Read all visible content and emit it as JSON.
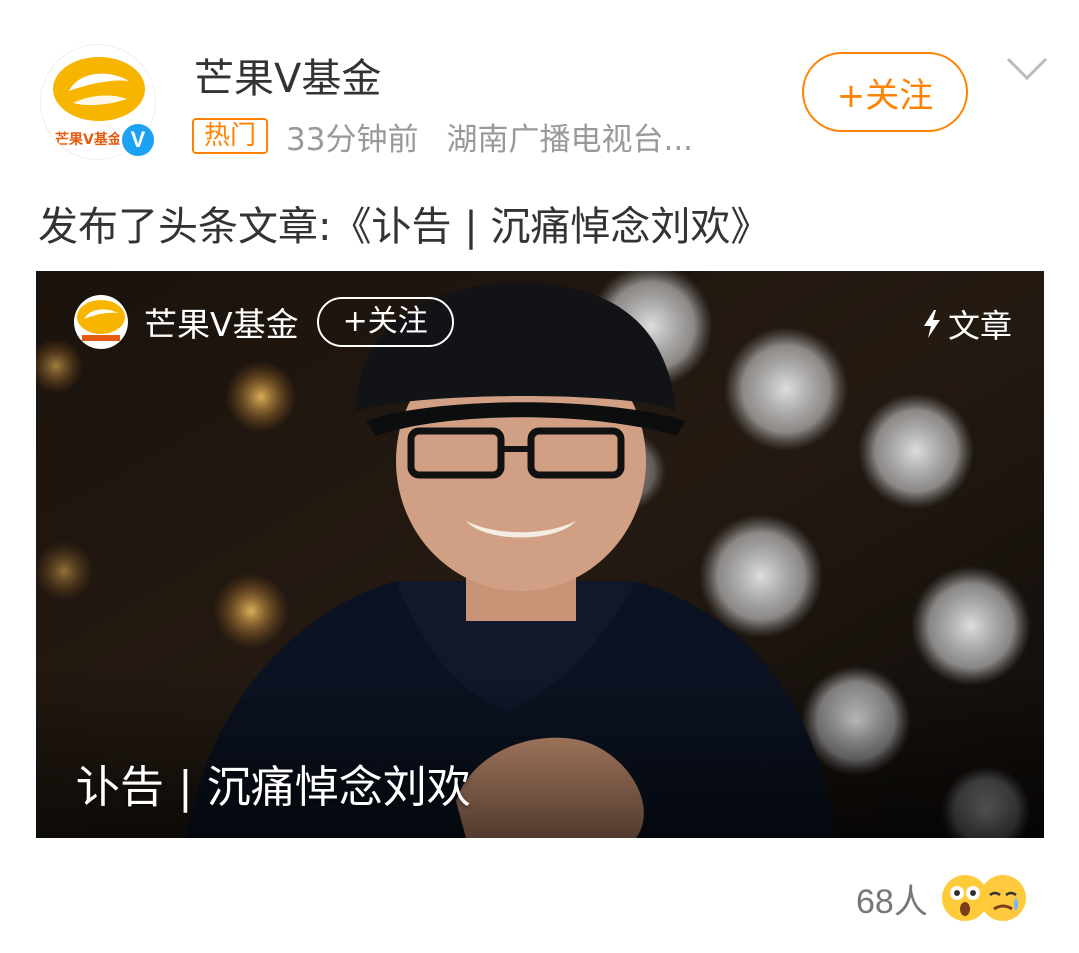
{
  "post": {
    "user_name": "芒果V基金",
    "avatar_text": "芒果V基金",
    "verified_mark": "V",
    "hot_tag": "热门",
    "time": "33分钟前",
    "source": "湖南广播电视台...",
    "follow_label": "+关注",
    "text": "发布了头条文章:《讣告 | 沉痛悼念刘欢》"
  },
  "article_card": {
    "author_name": "芒果V基金",
    "follow_label": "+关注",
    "type_label": "文章",
    "title": "讣告 | 沉痛悼念刘欢"
  },
  "reactions": {
    "count_label": "68人",
    "emojis": [
      "shocked-emoji",
      "crying-emoji"
    ]
  },
  "colors": {
    "accent": "#ff8200",
    "verified": "#1da1f2",
    "text": "#333333",
    "meta": "#999999"
  }
}
